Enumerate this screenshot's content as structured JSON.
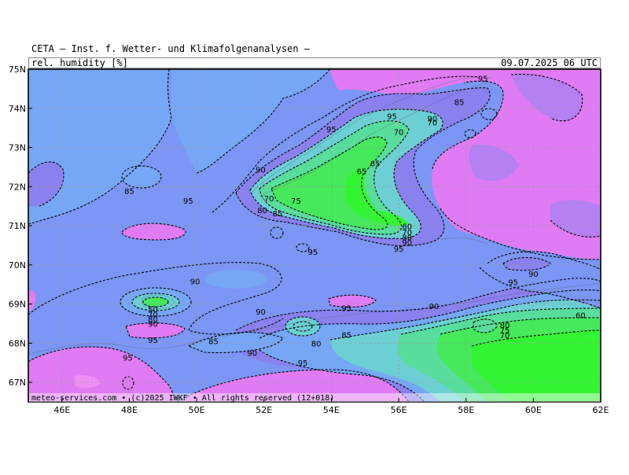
{
  "header": {
    "title": "CETA — Inst. f. Wetter- und Klimafolgenanalysen —",
    "variable": "rel. humidity [%]",
    "datetime": "09.07.2025 06 UTC"
  },
  "footer": {
    "credit": "meteo-services.com • (c)2025 IWKF • All rights reserved (12+018)"
  },
  "axes": {
    "lat_labels": [
      "75N",
      "74N",
      "73N",
      "72N",
      "71N",
      "70N",
      "69N",
      "68N",
      "67N"
    ],
    "lon_labels": [
      "46E",
      "48E",
      "50E",
      "52E",
      "54E",
      "56E",
      "58E",
      "60E",
      "62E"
    ],
    "lon_range": [
      45,
      62
    ],
    "lat_range": [
      66.5,
      75
    ],
    "grid": "dashed"
  },
  "colors": {
    "v50": "#33f533",
    "v60": "#46e85c",
    "v70": "#58dd9c",
    "v80": "#6ccfd4",
    "v85": "#76a6f6",
    "v90": "#7b96f4",
    "v95": "#8a80ee",
    "v100": "#e07bf4",
    "lake": "#a070f0"
  },
  "contour_labels": [
    {
      "text": "95",
      "lon": 58.5,
      "lat": 74.75
    },
    {
      "text": "85",
      "lon": 57.8,
      "lat": 74.15
    },
    {
      "text": "90",
      "lon": 57.0,
      "lat": 73.72
    },
    {
      "text": "70",
      "lon": 57.0,
      "lat": 73.62
    },
    {
      "text": "95",
      "lon": 55.8,
      "lat": 73.78
    },
    {
      "text": "70",
      "lon": 56.0,
      "lat": 73.38
    },
    {
      "text": "95",
      "lon": 54.0,
      "lat": 73.45
    },
    {
      "text": "65",
      "lon": 55.3,
      "lat": 72.58
    },
    {
      "text": "65",
      "lon": 54.9,
      "lat": 72.38
    },
    {
      "text": "90",
      "lon": 51.9,
      "lat": 72.42
    },
    {
      "text": "70",
      "lon": 52.15,
      "lat": 71.68
    },
    {
      "text": "75",
      "lon": 52.95,
      "lat": 71.62
    },
    {
      "text": "80",
      "lon": 51.95,
      "lat": 71.38
    },
    {
      "text": "85",
      "lon": 52.4,
      "lat": 71.3
    },
    {
      "text": "85",
      "lon": 48.0,
      "lat": 71.88
    },
    {
      "text": "95",
      "lon": 49.75,
      "lat": 71.62
    },
    {
      "text": "60",
      "lon": 56.25,
      "lat": 70.97
    },
    {
      "text": "70",
      "lon": 56.25,
      "lat": 70.82
    },
    {
      "text": "80",
      "lon": 56.25,
      "lat": 70.69
    },
    {
      "text": "90",
      "lon": 56.25,
      "lat": 70.56
    },
    {
      "text": "95",
      "lon": 56.0,
      "lat": 70.4
    },
    {
      "text": "95",
      "lon": 53.45,
      "lat": 70.32
    },
    {
      "text": "90",
      "lon": 49.95,
      "lat": 69.56
    },
    {
      "text": "90",
      "lon": 60.0,
      "lat": 69.76
    },
    {
      "text": "95",
      "lon": 59.4,
      "lat": 69.54
    },
    {
      "text": "50",
      "lon": 48.7,
      "lat": 68.85
    },
    {
      "text": "70",
      "lon": 48.7,
      "lat": 68.72
    },
    {
      "text": "80",
      "lon": 48.7,
      "lat": 68.6
    },
    {
      "text": "90",
      "lon": 48.7,
      "lat": 68.48
    },
    {
      "text": "95",
      "lon": 54.45,
      "lat": 68.88
    },
    {
      "text": "90",
      "lon": 51.9,
      "lat": 68.79
    },
    {
      "text": "90",
      "lon": 57.05,
      "lat": 68.93
    },
    {
      "text": "60",
      "lon": 61.4,
      "lat": 68.7
    },
    {
      "text": "95",
      "lon": 48.7,
      "lat": 68.07
    },
    {
      "text": "85",
      "lon": 50.5,
      "lat": 68.04
    },
    {
      "text": "80",
      "lon": 53.55,
      "lat": 67.98
    },
    {
      "text": "85",
      "lon": 54.45,
      "lat": 68.2
    },
    {
      "text": "80",
      "lon": 59.15,
      "lat": 68.45
    },
    {
      "text": "75",
      "lon": 59.15,
      "lat": 68.32
    },
    {
      "text": "70",
      "lon": 59.15,
      "lat": 68.19
    },
    {
      "text": "90",
      "lon": 51.65,
      "lat": 67.74
    },
    {
      "text": "95",
      "lon": 47.95,
      "lat": 67.62
    },
    {
      "text": "95",
      "lon": 53.15,
      "lat": 67.48
    }
  ]
}
